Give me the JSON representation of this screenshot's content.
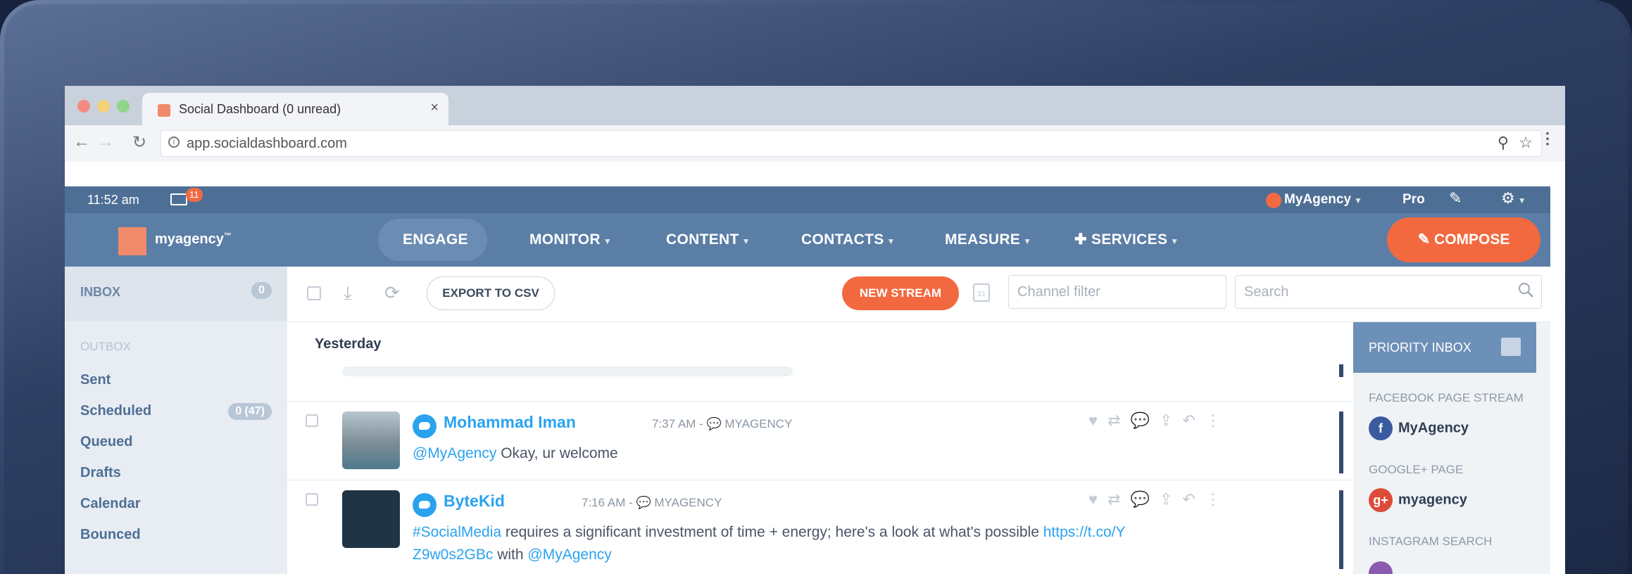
{
  "browser": {
    "tab_title": "Social Dashboard (0 unread)",
    "tab_close": "×",
    "url": "app.socialdashboard.com",
    "back": "←",
    "forward": "→",
    "reload": "↻"
  },
  "status": {
    "time": "11:52 am",
    "mail_badge": "11",
    "account": "MyAgency",
    "plan": "Pro"
  },
  "nav": {
    "logo": "myagency",
    "logo_mark": "™",
    "items": [
      "ENGAGE",
      "MONITOR",
      "CONTENT",
      "CONTACTS",
      "MEASURE",
      "SERVICES"
    ],
    "compose": "COMPOSE"
  },
  "sidebar": {
    "inbox": "INBOX",
    "inbox_count": "0",
    "outbox": "OUTBOX",
    "items": [
      "Sent",
      "Scheduled",
      "Queued",
      "Drafts",
      "Calendar",
      "Bounced"
    ],
    "scheduled_count": "0 (47)"
  },
  "toolbar": {
    "export": "EXPORT TO CSV",
    "new_stream": "NEW STREAM",
    "calendar_day": "31",
    "channel_placeholder": "Channel filter",
    "search_placeholder": "Search"
  },
  "feed": {
    "day": "Yesterday",
    "posts": [
      {
        "author": "Mohammad Iman",
        "meta": "7:37 AM - 💬 MYAGENCY",
        "mention": "@MyAgency",
        "text": " Okay, ur welcome"
      },
      {
        "author": "ByteKid",
        "meta": "7:16 AM - 💬 MYAGENCY",
        "hashtag": "#SocialMedia",
        "text": " requires a significant investment of time + energy; here's a look at what's possible ",
        "link": "https://t.co/Y",
        "link2": "Z9w0s2GBc",
        "with": " with ",
        "mention": "@MyAgency"
      }
    ]
  },
  "priority": {
    "title": "PRIORITY INBOX",
    "sections": [
      {
        "label": "FACEBOOK PAGE STREAM",
        "channel": "MyAgency"
      },
      {
        "label": "GOOGLE+ PAGE",
        "channel": "myagency"
      },
      {
        "label": "INSTAGRAM SEARCH"
      }
    ]
  },
  "colors": {
    "accent": "#f2693f",
    "nav": "#5b7ea6",
    "twitter": "#2aa3ef"
  }
}
